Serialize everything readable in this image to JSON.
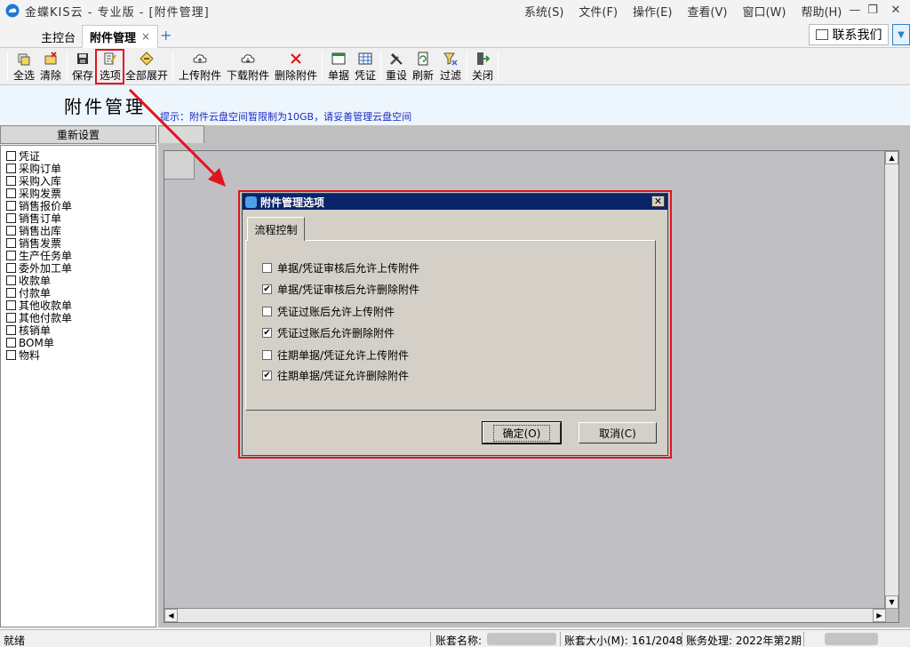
{
  "window": {
    "title": "金蝶KIS云 - 专业版 - [附件管理]",
    "menu": [
      "系统(S)",
      "文件(F)",
      "操作(E)",
      "查看(V)",
      "窗口(W)",
      "帮助(H)"
    ]
  },
  "tabs": {
    "home": "主控台",
    "active": "附件管理",
    "close": "×",
    "add": "+",
    "contact": "联系我们"
  },
  "toolbar": {
    "select_all": "全选",
    "clear": "清除",
    "save": "保存",
    "options": "选项",
    "expand_all": "全部展开",
    "upload": "上传附件",
    "download": "下载附件",
    "delete": "删除附件",
    "document": "单据",
    "voucher": "凭证",
    "reset": "重设",
    "refresh": "刷新",
    "filter": "过滤",
    "close": "关闭"
  },
  "header": {
    "title": "附件管理",
    "tip": "提示：附件云盘空间暂限制为10GB，请妥善管理云盘空间"
  },
  "left_panel": {
    "reset_button": "重新设置",
    "items": [
      "凭证",
      "采购订单",
      "采购入库",
      "采购发票",
      "销售报价单",
      "销售订单",
      "销售出库",
      "销售发票",
      "生产任务单",
      "委外加工单",
      "收款单",
      "付款单",
      "其他收款单",
      "其他付款单",
      "核销单",
      "BOM单",
      "物料"
    ]
  },
  "dialog": {
    "title": "附件管理选项",
    "close": "✕",
    "tab": "流程控制",
    "options": [
      {
        "label": "单据/凭证审核后允许上传附件",
        "checked": false
      },
      {
        "label": "单据/凭证审核后允许删除附件",
        "checked": true
      },
      {
        "label": "凭证过账后允许上传附件",
        "checked": false
      },
      {
        "label": "凭证过账后允许删除附件",
        "checked": true
      },
      {
        "label": "往期单据/凭证允许上传附件",
        "checked": false
      },
      {
        "label": "往期单据/凭证允许删除附件",
        "checked": true
      }
    ],
    "ok": "确定(O)",
    "cancel": "取消(C)"
  },
  "statusbar": {
    "ready": "就绪",
    "account_name_label": "账套名称:",
    "account_size": "账套大小(M): 161/2048",
    "period": "账务处理: 2022年第2期"
  },
  "colors": {
    "highlight": "#e0141e",
    "dialog_title": "#0a246a",
    "tip_text": "#1a2bbf"
  }
}
